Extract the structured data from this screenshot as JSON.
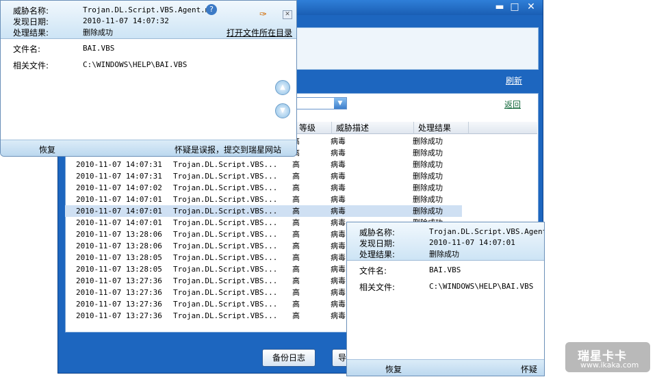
{
  "window": {
    "min_icon": "minimize-icon",
    "max_icon": "maximize-icon",
    "close_icon": "close-icon"
  },
  "toolbar": {
    "refresh": "刷新",
    "back": "返回"
  },
  "table": {
    "headers": [
      "等级",
      "威胁描述",
      "处理结果"
    ],
    "rows": [
      {
        "level": "高",
        "desc": "病毒",
        "result": "删除成功",
        "partial": true
      },
      {
        "level": "高",
        "desc": "病毒",
        "result": "删除成功",
        "partial": true
      },
      {
        "time": "2010-11-07 14:07:31",
        "name": "Trojan.DL.Script.VBS...",
        "level": "高",
        "desc": "病毒",
        "result": "删除成功"
      },
      {
        "time": "2010-11-07 14:07:31",
        "name": "Trojan.DL.Script.VBS...",
        "level": "高",
        "desc": "病毒",
        "result": "删除成功"
      },
      {
        "time": "2010-11-07 14:07:02",
        "name": "Trojan.DL.Script.VBS...",
        "level": "高",
        "desc": "病毒",
        "result": "删除成功"
      },
      {
        "time": "2010-11-07 14:07:01",
        "name": "Trojan.DL.Script.VBS...",
        "level": "高",
        "desc": "病毒",
        "result": "删除成功"
      },
      {
        "time": "2010-11-07 14:07:01",
        "name": "Trojan.DL.Script.VBS...",
        "level": "高",
        "desc": "病毒",
        "result": "删除成功",
        "selected": true
      },
      {
        "time": "2010-11-07 14:07:01",
        "name": "Trojan.DL.Script.VBS...",
        "level": "高",
        "desc": "病毒",
        "result": "删除成功"
      },
      {
        "time": "2010-11-07 13:28:06",
        "name": "Trojan.DL.Script.VBS...",
        "level": "高",
        "desc": "病毒",
        "result": ""
      },
      {
        "time": "2010-11-07 13:28:06",
        "name": "Trojan.DL.Script.VBS...",
        "level": "高",
        "desc": "病毒",
        "result": ""
      },
      {
        "time": "2010-11-07 13:28:05",
        "name": "Trojan.DL.Script.VBS...",
        "level": "高",
        "desc": "病毒",
        "result": ""
      },
      {
        "time": "2010-11-07 13:28:05",
        "name": "Trojan.DL.Script.VBS...",
        "level": "高",
        "desc": "病毒",
        "result": ""
      },
      {
        "time": "2010-11-07 13:27:36",
        "name": "Trojan.DL.Script.VBS...",
        "level": "高",
        "desc": "病毒",
        "result": ""
      },
      {
        "time": "2010-11-07 13:27:36",
        "name": "Trojan.DL.Script.VBS...",
        "level": "高",
        "desc": "病毒",
        "result": ""
      },
      {
        "time": "2010-11-07 13:27:36",
        "name": "Trojan.DL.Script.VBS...",
        "level": "高",
        "desc": "病毒",
        "result": ""
      },
      {
        "time": "2010-11-07 13:27:36",
        "name": "Trojan.DL.Script.VBS...",
        "level": "高",
        "desc": "病毒",
        "result": ""
      }
    ]
  },
  "buttons": {
    "backup_log": "备份日志",
    "partial": "导"
  },
  "popup1": {
    "threat_label": "威胁名称:",
    "threat_value": "Trojan.DL.Script.VBS.Agent.mm",
    "date_label": "发现日期:",
    "date_value": "2010-11-07 14:07:32",
    "result_label": "处理结果:",
    "result_value": "删除成功",
    "open_dir": "打开文件所在目录",
    "file_label": "文件名:",
    "file_value": "BAI.VBS",
    "related_label": "相关文件:",
    "related_value": "C:\\WINDOWS\\HELP\\BAI.VBS",
    "restore": "恢复",
    "report": "怀疑是误报，提交到瑞星网站"
  },
  "popup2": {
    "threat_label": "威胁名称:",
    "threat_value": "Trojan.DL.Script.VBS.Agent.m",
    "date_label": "发现日期:",
    "date_value": "2010-11-07 14:07:01",
    "result_label": "处理结果:",
    "result_value": "删除成功",
    "file_label": "文件名:",
    "file_value": "BAI.VBS",
    "related_label": "相关文件:",
    "related_value": "C:\\WINDOWS\\HELP\\BAI.VBS",
    "restore": "恢复",
    "report": "怀疑是"
  },
  "watermark": {
    "brand": "瑞星卡卡",
    "url": "www.ikaka.com"
  }
}
